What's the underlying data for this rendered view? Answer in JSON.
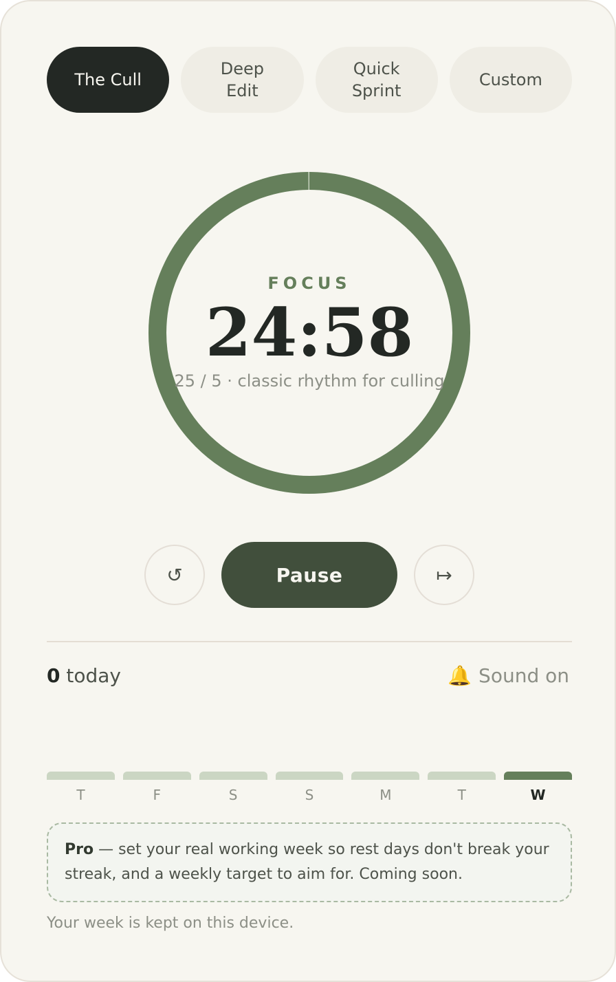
{
  "tabs": [
    {
      "label": "The Cull",
      "active": true
    },
    {
      "label": "Deep Edit",
      "active": false
    },
    {
      "label": "Quick Sprint",
      "active": false
    },
    {
      "label": "Custom",
      "active": false
    }
  ],
  "timer": {
    "phase": "FOCUS",
    "time": "24:58",
    "subtitle": "25 / 5 · classic rhythm for culling",
    "progress_fraction": 0.9987
  },
  "controls": {
    "reset_icon": "↺",
    "pause_label": "Pause",
    "skip_icon": "↦"
  },
  "stats": {
    "today_count": "0",
    "today_label": "today",
    "sound_icon": "bell-icon",
    "sound_label": "Sound on"
  },
  "week": {
    "days": [
      {
        "label": "T",
        "current": false
      },
      {
        "label": "F",
        "current": false
      },
      {
        "label": "S",
        "current": false
      },
      {
        "label": "S",
        "current": false
      },
      {
        "label": "M",
        "current": false
      },
      {
        "label": "T",
        "current": false
      },
      {
        "label": "W",
        "current": true
      }
    ]
  },
  "pro": {
    "title": "Pro",
    "text": " — set your real working week so rest days don't break your streak, and a weekly target to aim for. Coming soon."
  },
  "footnote": "Your week is kept on this device.",
  "colors": {
    "accent": "#657f5b",
    "dark": "#232824",
    "pause_bg": "#414f3c",
    "bar_inactive": "#cbd6c3"
  }
}
